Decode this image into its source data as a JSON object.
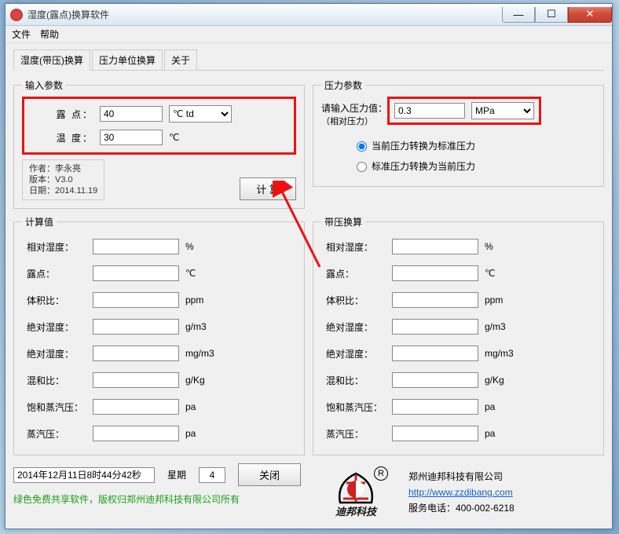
{
  "window": {
    "title": "湿度(露点)换算软件"
  },
  "menu": {
    "file": "文件",
    "help": "帮助"
  },
  "tabs": {
    "t1": "湿度(带压)换算",
    "t2": "压力单位换算",
    "t3": "关于"
  },
  "input_group": {
    "legend": "输入参数",
    "dewpoint_label": "露 点：",
    "dewpoint_value": "40",
    "dewpoint_unit": "℃ td",
    "temp_label": "温 度：",
    "temp_value": "30",
    "temp_unit": "℃",
    "author_l1": "作者：李永亮",
    "author_l2": "版本：V3.0",
    "author_l3": "日期：2014.11.19",
    "calc_btn": "计 算"
  },
  "pressure_group": {
    "legend": "压力参数",
    "input_label": "请输入压力值：",
    "input_note": "（相对压力）",
    "input_value": "0.3",
    "unit": "MPa",
    "opt1": "当前压力转换为标准压力",
    "opt2": "标准压力转换为当前压力"
  },
  "calc_group": {
    "legend": "计算值",
    "r1": "相对湿度：",
    "u1": "%",
    "r2": "露点：",
    "u2": "℃",
    "r3": "体积比：",
    "u3": "ppm",
    "r4": "绝对湿度：",
    "u4": "g/m3",
    "r5": "绝对湿度：",
    "u5": "mg/m3",
    "r6": "混和比：",
    "u6": "g/Kg",
    "r7": "饱和蒸汽压：",
    "u7": "pa",
    "r8": "蒸汽压：",
    "u8": "pa"
  },
  "pcalc_group": {
    "legend": "带压换算",
    "r1": "相对湿度：",
    "u1": "%",
    "r2": "露点：",
    "u2": "℃",
    "r3": "体积比：",
    "u3": "ppm",
    "r4": "绝对湿度：",
    "u4": "g/m3",
    "r5": "绝对湿度：",
    "u5": "mg/m3",
    "r6": "混和比：",
    "u6": "g/Kg",
    "r7": "饱和蒸汽压：",
    "u7": "pa",
    "r8": "蒸汽压：",
    "u8": "pa"
  },
  "status": {
    "datetime": "2014年12月11日8时44分42秒",
    "week_label": "星期",
    "week_value": "4",
    "close_btn": "关闭"
  },
  "footer": {
    "green": "绿色免费共享软件，版权归郑州迪邦科技有限公司所有",
    "logo_text": "迪邦科技",
    "company": "郑州迪邦科技有限公司",
    "url": "http://www.zzdibang.com",
    "tel": "服务电话：400-002-6218"
  }
}
